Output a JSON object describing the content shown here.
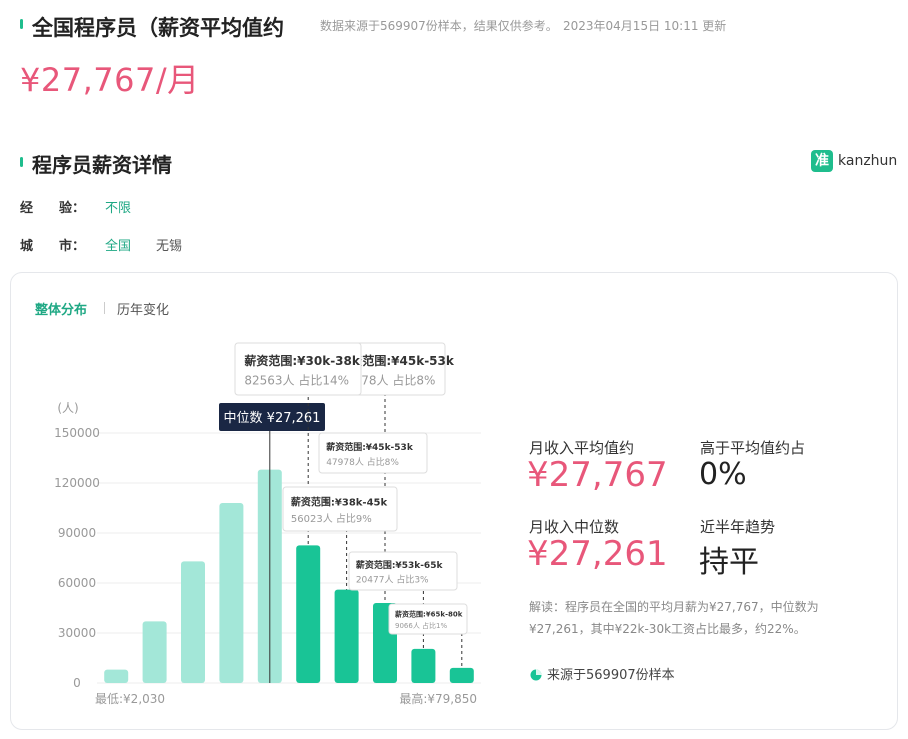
{
  "header": {
    "title": "全国程序员（薪资平均值约",
    "meta_source": "数据来源于569907份样本，结果仅供参考。",
    "meta_time": "2023年04月15日 10:11 更新",
    "price": "¥27,767/月"
  },
  "section": {
    "title": "程序员薪资详情",
    "brand_mark": "准",
    "brand": "kanzhun"
  },
  "filters": {
    "experience": {
      "label": "经　　验：",
      "value": "不限"
    },
    "city": {
      "label": "城　　市：",
      "options": [
        "全国",
        "无锡"
      ]
    }
  },
  "tabs": [
    "整体分布",
    "历年变化"
  ],
  "chart_data": {
    "type": "bar",
    "yunit": "(人)",
    "ylim": [
      0,
      150000
    ],
    "yticks": [
      "150000",
      "120000",
      "90000",
      "60000",
      "30000",
      "0"
    ],
    "values": [
      8000,
      37000,
      73000,
      108000,
      128000,
      82563,
      56023,
      47978,
      20477,
      9066
    ],
    "median_index": 5,
    "x_min_label": "最低:¥2,030",
    "x_max_label": "最高:¥79,850",
    "median_label": "中位数 ¥27,261",
    "tooltips": [
      {
        "range": "薪资范围:¥30k-38k",
        "detail": "82563人  占比14%"
      },
      {
        "range": "薪资范围:¥45k-53k",
        "detail": "47978人  占比8%"
      },
      {
        "range": "薪资范围:¥45k-53k",
        "detail": "47978人  占比8%"
      },
      {
        "range": "薪资范围:¥38k-45k",
        "detail": "56023人  占比9%"
      },
      {
        "range": "薪资范围:¥53k-65k",
        "detail": "20477人  占比3%"
      },
      {
        "range": "薪资范围:¥65k-80k",
        "detail": "9066人  占比1%"
      }
    ],
    "colors": {
      "light": "#a3e7d8",
      "dark": "#19c496"
    }
  },
  "stats": {
    "avg_label": "月收入平均值约",
    "avg_value": "¥27,767",
    "above_label": "高于平均值约占",
    "above_value": "0%",
    "median_label": "月收入中位数",
    "median_value": "¥27,261",
    "trend_label": "近半年趋势",
    "trend_value": "持平"
  },
  "note": "解读：程序员在全国的平均月薪为¥27,767，中位数为¥27,261，其中¥22k-30k工资占比最多，约22%。",
  "source": "来源于569907份样本"
}
